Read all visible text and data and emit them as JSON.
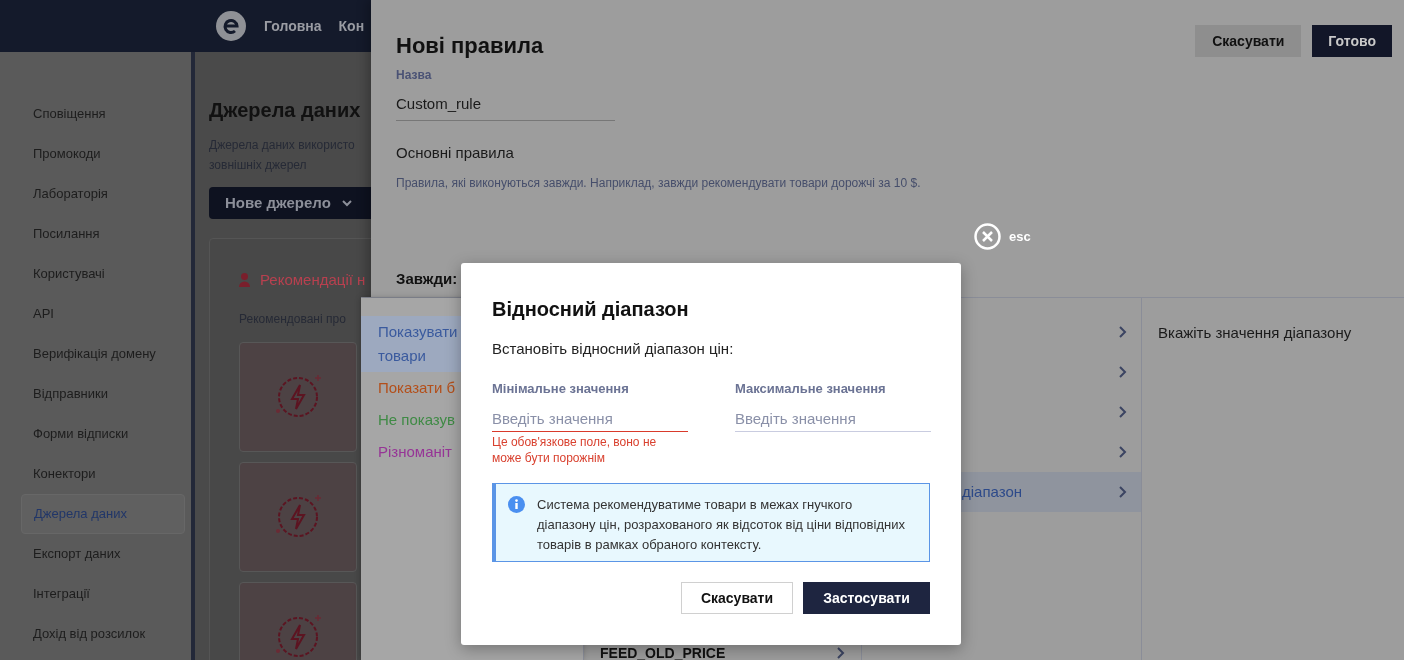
{
  "nav": {
    "items": [
      "Головна",
      "Кон"
    ]
  },
  "sidebar": {
    "items": [
      {
        "label": "Сповіщення",
        "selected": false
      },
      {
        "label": "Промокоди",
        "selected": false
      },
      {
        "label": "Лабораторія",
        "selected": false
      },
      {
        "label": "Посилання",
        "selected": false
      },
      {
        "label": "Користувачі",
        "selected": false
      },
      {
        "label": "API",
        "selected": false
      },
      {
        "label": "Верифікація домену",
        "selected": false
      },
      {
        "label": "Відправники",
        "selected": false
      },
      {
        "label": "Форми відписки",
        "selected": false
      },
      {
        "label": "Конектори",
        "selected": false
      },
      {
        "label": "Джерела даних",
        "selected": true
      },
      {
        "label": "Експорт даних",
        "selected": false
      },
      {
        "label": "Інтеграції",
        "selected": false
      },
      {
        "label": "Дохід від розсилок",
        "selected": false
      }
    ]
  },
  "page": {
    "title": "Джерела даних",
    "description_lines": [
      "Джерела даних використо",
      "зовнішніх джерел"
    ],
    "new_button": "Нове джерело",
    "card": {
      "title": "Рекомендації н",
      "subtitle": "Рекомендовані про"
    }
  },
  "drawer": {
    "title": "Нові правила",
    "cancel": "Скасувати",
    "done": "Готово",
    "name_label": "Назва",
    "name_value": "Custom_rule",
    "section_title": "Основні правила",
    "section_hint": "Правила, які виконуються завжди. Наприклад, завжди рекомендувати товари дорожчі за 10 $.",
    "always_label": "Завжди:"
  },
  "close_hint": "esc",
  "rule_menu": {
    "categories": [
      {
        "label": "Показувати товари",
        "color": "#3a5a9e",
        "selected": true
      },
      {
        "label": "Показати б",
        "color": "#b34f1a",
        "selected": false
      },
      {
        "label": "Не показув",
        "color": "#3f8a45",
        "selected": false
      },
      {
        "label": "Різноманіт",
        "color": "#963596",
        "selected": false
      }
    ],
    "field_option": "FEED_OLD_PRICE",
    "options": [
      {
        "selected": false
      },
      {
        "selected": false
      },
      {
        "selected": false
      },
      {
        "selected": false
      },
      {
        "label": "діапазон",
        "selected": true
      }
    ],
    "detail_text": "Вкажіть значення діапазону"
  },
  "modal": {
    "title": "Відносний діапазон",
    "subtitle": "Встановіть відносний діапазон цін:",
    "fields": [
      {
        "label": "Мінімальне значення",
        "placeholder": "Введіть значення",
        "invalid": true,
        "error": "Це обов'язкове поле, воно не може бути порожнім"
      },
      {
        "label": "Максимальне значення",
        "placeholder": "Введіть значення",
        "invalid": false
      }
    ],
    "info": "Система рекомендуватиме товари в межах гнучкого діапазону цін, розрахованого як відсоток від ціни відповідних товарів в рамках обраного контексту.",
    "cancel": "Скасувати",
    "apply": "Застосувати"
  }
}
